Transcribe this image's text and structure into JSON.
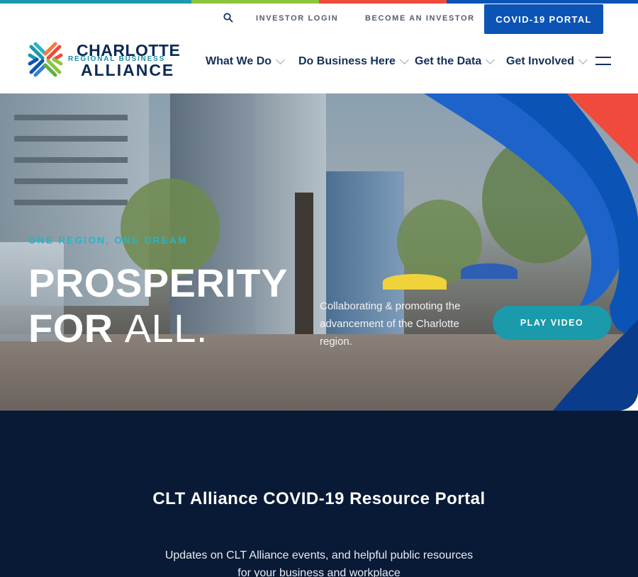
{
  "colors": {
    "stripe": [
      "#1a9aaa",
      "#8cc63f",
      "#ef4a3c",
      "#0b54b5"
    ],
    "navy": "#091a36",
    "accent_teal": "#1a9aaa",
    "accent_blue": "#0b54b5",
    "accent_red": "#ef4a3c"
  },
  "utility": {
    "search_icon": "search-icon",
    "investor_login": "INVESTOR LOGIN",
    "become_investor": "BECOME AN INVESTOR",
    "covid_portal": "COVID-19 PORTAL"
  },
  "logo": {
    "line1": "CHARLOTTE",
    "line2": "REGIONAL BUSINESS",
    "line3": "ALLIANCE"
  },
  "nav": {
    "items": [
      {
        "label": "What We Do"
      },
      {
        "label": "Do Business Here"
      },
      {
        "label": "Get the Data"
      },
      {
        "label": "Get Involved"
      }
    ],
    "menu_icon": "hamburger-menu-icon"
  },
  "hero": {
    "eyebrow": "ONE REGION, ONE DREAM",
    "headline_line1": "PROSPERITY",
    "headline_bold": "FOR",
    "headline_thin": "ALL.",
    "description": "Collaborating & promoting the advancement of the Charlotte region.",
    "play_button": "PLAY VIDEO"
  },
  "covid": {
    "title": "CLT Alliance COVID-19 Resource Portal",
    "subtitle": "Updates on CLT Alliance events, and helpful public resources for your business and workplace"
  }
}
